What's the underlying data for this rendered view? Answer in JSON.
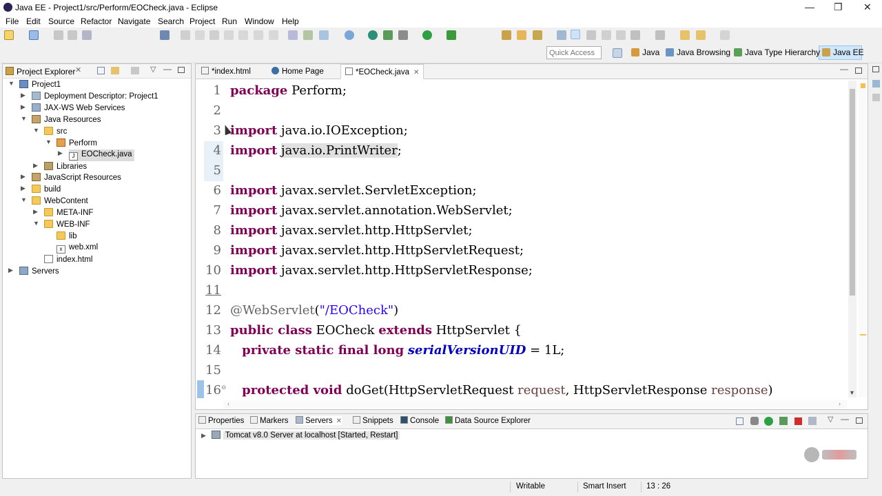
{
  "window": {
    "title": "Java EE - Project1/src/Perform/EOCheck.java - Eclipse"
  },
  "menu": [
    "File",
    "Edit",
    "Source",
    "Refactor",
    "Navigate",
    "Search",
    "Project",
    "Run",
    "Window",
    "Help"
  ],
  "toolbar": {
    "quick_access_placeholder": "Quick Access",
    "perspectives": [
      "Java",
      "Java Browsing",
      "Java Type Hierarchy",
      "Java EE"
    ]
  },
  "explorer": {
    "title": "Project Explorer",
    "items": [
      {
        "label": "Project1"
      },
      {
        "label": "Deployment Descriptor: Project1"
      },
      {
        "label": "JAX-WS Web Services"
      },
      {
        "label": "Java Resources"
      },
      {
        "label": "src"
      },
      {
        "label": "Perform"
      },
      {
        "label": "EOCheck.java"
      },
      {
        "label": "Libraries"
      },
      {
        "label": "JavaScript Resources"
      },
      {
        "label": "build"
      },
      {
        "label": "WebContent"
      },
      {
        "label": "META-INF"
      },
      {
        "label": "WEB-INF"
      },
      {
        "label": "lib"
      },
      {
        "label": "web.xml"
      },
      {
        "label": "index.html"
      },
      {
        "label": "Servers"
      }
    ]
  },
  "editor": {
    "tabs": [
      {
        "label": "*index.html"
      },
      {
        "label": "Home Page"
      },
      {
        "label": "*EOCheck.java"
      }
    ],
    "line_numbers": [
      "1",
      "2",
      "3",
      "4",
      "5",
      "6",
      "7",
      "8",
      "9",
      "10",
      "11",
      "12",
      "13",
      "14",
      "15",
      "16"
    ]
  },
  "bottom": {
    "tabs": [
      "Properties",
      "Markers",
      "Servers",
      "Snippets",
      "Console",
      "Data Source Explorer"
    ],
    "server_entry": "Tomcat v8.0 Server at localhost  [Started, Restart]"
  },
  "status": {
    "writable": "Writable",
    "insert_mode": "Smart Insert",
    "position": "13 : 26"
  }
}
